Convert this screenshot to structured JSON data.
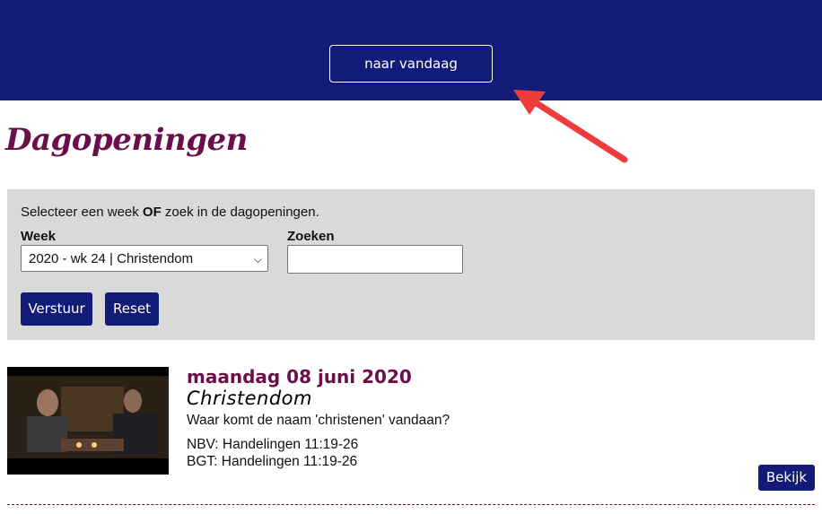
{
  "header": {
    "today_button": "naar vandaag"
  },
  "page_title": "Dagopeningen",
  "filter": {
    "intro_before": "Selecteer een week ",
    "intro_bold": "OF",
    "intro_after": " zoek in de dagopeningen.",
    "week_label": "Week",
    "week_selected": "2020 - wk 24 | Christendom",
    "search_label": "Zoeken",
    "search_value": "",
    "submit_label": "Verstuur",
    "reset_label": "Reset"
  },
  "items": [
    {
      "date": "maandag 08 juni 2020",
      "title": "Christendom",
      "question": "Waar komt de naam 'christenen' vandaan?",
      "ref_nbv": "NBV: Handelingen 11:19-26",
      "ref_bgt": "BGT: Handelingen 11:19-26",
      "view_label": "Bekijk"
    }
  ],
  "colors": {
    "header_bg": "#131b78",
    "title": "#6a0f4a",
    "panel_bg": "#d9d9d9",
    "button_bg": "#131b78",
    "annotation_arrow": "#ef3b3b"
  }
}
